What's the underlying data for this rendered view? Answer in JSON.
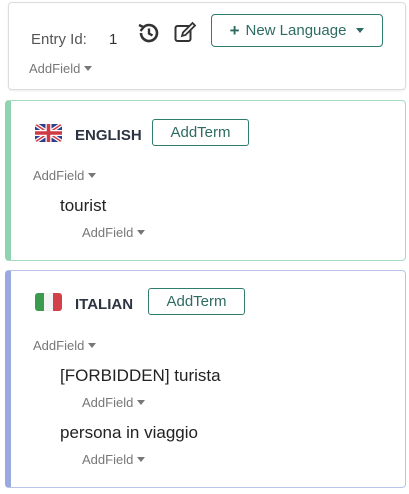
{
  "header": {
    "entry_id_label": "Entry Id:",
    "entry_id_value": "1",
    "new_language_label": "New Language",
    "add_field_label": "AddField"
  },
  "languages": [
    {
      "name": "ENGLISH",
      "flag": "uk-flag-icon",
      "add_term_label": "AddTerm",
      "add_field_label": "AddField",
      "accent_color": "#8fd3b0",
      "terms": [
        {
          "text": "tourist",
          "add_field_label": "AddField"
        }
      ]
    },
    {
      "name": "ITALIAN",
      "flag": "italy-flag-icon",
      "add_term_label": "AddTerm",
      "add_field_label": "AddField",
      "accent_color": "#9aa9df",
      "terms": [
        {
          "text": "[FORBIDDEN] turista",
          "add_field_label": "AddField"
        },
        {
          "text": "persona in viaggio",
          "add_field_label": "AddField"
        }
      ]
    }
  ],
  "colors": {
    "button_border": "#2e7d6f",
    "button_text": "#2e6b61"
  }
}
